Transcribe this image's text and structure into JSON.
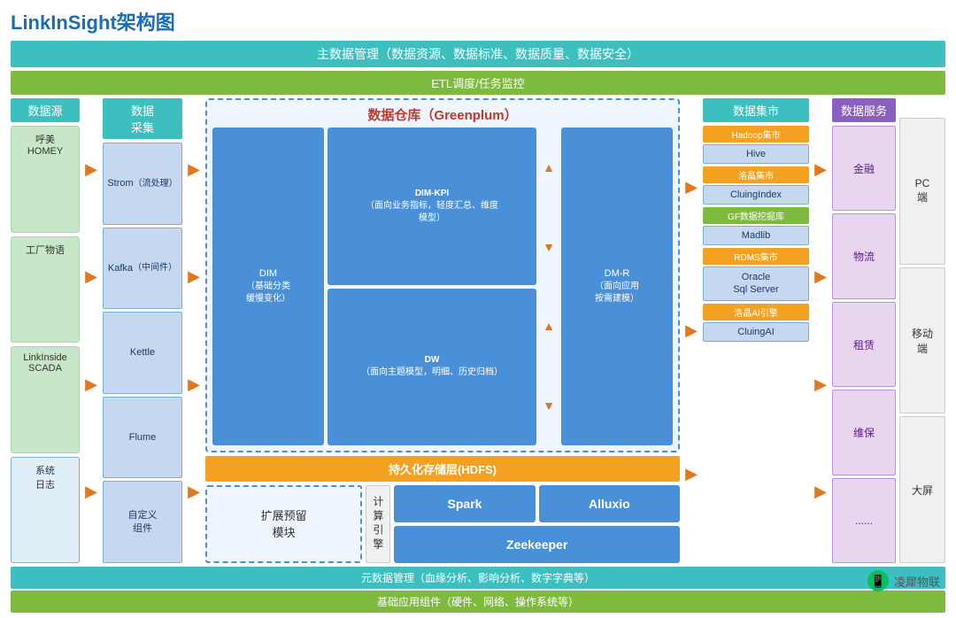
{
  "title": "LinkInSight架构图",
  "banners": {
    "master_data": "主数据管理（数据资源、数据标准、数据质量、数据安全）",
    "etl": "ETL调度/任务监控",
    "meta_data": "元数据管理（血缘分析、影响分析、数字字典等）",
    "base_app": "基础应用组件（硬件、网络、操作系统等）"
  },
  "columns": {
    "source": {
      "header": "数据源",
      "items": [
        {
          "label": "呼美\nHOMEY",
          "type": "cylinder"
        },
        {
          "label": "工厂物语",
          "type": "cylinder"
        },
        {
          "label": "LinkInside\nSCADA",
          "type": "cylinder"
        },
        {
          "label": "系统\n日志",
          "type": "doc"
        }
      ]
    },
    "collect": {
      "header": "数据\n采集",
      "items": [
        {
          "label": "Strom\n（流处理）"
        },
        {
          "label": "Kafka\n（中间件）"
        },
        {
          "label": "Kettle"
        },
        {
          "label": "Flume"
        },
        {
          "label": "自定义\n组件"
        }
      ]
    },
    "dw": {
      "title": "数据仓库（Greenplum）",
      "dim_label": "DIM\n（基础分类\n缓慢变化）",
      "dim_kpi_label": "DIM-KPI\n（面向业务指标，轻度汇总、维度\n模型）",
      "dw_label": "DW\n（面向主题模型，明细、历史归档）",
      "dm_r_label": "DM-R\n（面向应用\n按需建模）",
      "hdfs_label": "持久化存储层(HDFS)",
      "expand_label": "扩展预留\n模块",
      "compute_label": "计\n算\n引\n擎",
      "spark_label": "Spark",
      "alluxio_label": "Alluxio",
      "zk_label": "Zeekeeper"
    },
    "mart": {
      "header": "数据集市",
      "groups": [
        {
          "label": "Hadoop集市",
          "label_color": "hadoop",
          "item": "Hive"
        },
        {
          "label": "洛晶集市",
          "label_color": "luojing",
          "item": "CluingIndex"
        },
        {
          "label": "GF数据挖掘库",
          "label_color": "gf",
          "item": "Madlib"
        },
        {
          "label": "RDMS集市",
          "label_color": "rdms",
          "item": "Oracle\nSql Server"
        },
        {
          "label": "洛晶AI引擎",
          "label_color": "luojingai",
          "item": "CluingAI"
        }
      ]
    },
    "service": {
      "header": "数据服务",
      "items": [
        "金融",
        "物流",
        "租赁",
        "维保",
        "......"
      ]
    },
    "device": {
      "items": [
        "PC\n端",
        "移动\n端",
        "大屏"
      ]
    }
  },
  "wechat": {
    "label": "凌犀物联"
  }
}
